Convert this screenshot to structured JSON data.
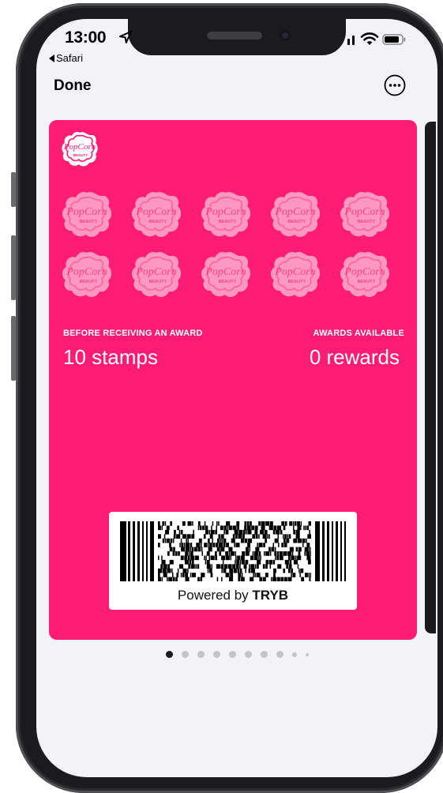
{
  "status_bar": {
    "time": "13:00",
    "back_app": "Safari"
  },
  "nav": {
    "done_label": "Done"
  },
  "pass": {
    "background_color": "#ff1c75",
    "logo_text_top": "PopCorn",
    "logo_text_bottom": "BEAUTY",
    "stamp_count": 10,
    "stamps_filled": 0,
    "fields": {
      "left_label": "BEFORE RECEIVING AN AWARD",
      "left_value": "10 stamps",
      "right_label": "AWARDS AVAILABLE",
      "right_value": "0 rewards"
    },
    "barcode": {
      "type": "PDF417",
      "powered_prefix": "Powered by",
      "powered_brand": "TRYB"
    }
  },
  "pagination": {
    "total": 10,
    "current": 1
  },
  "icons": {
    "location": "location-arrow-icon",
    "signal": "cellular-signal-icon",
    "wifi": "wifi-icon",
    "battery": "battery-icon",
    "more": "ellipsis-circle-icon"
  }
}
